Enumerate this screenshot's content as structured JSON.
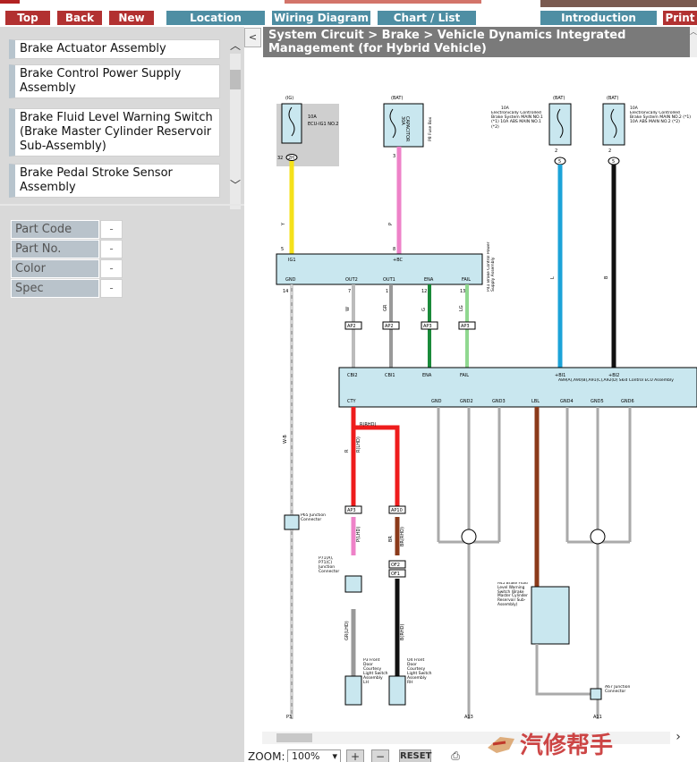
{
  "nav": {
    "top": "Top",
    "back": "Back",
    "new": "New",
    "location": "Location",
    "wiring": "Wiring Diagram",
    "chart": "Chart / List",
    "introduction": "Introduction",
    "print": "Print"
  },
  "components": [
    "Brake Actuator Assembly",
    "Brake Control Power Supply Assembly",
    "Brake Fluid Level Warning Switch (Brake Master Cylinder Reservoir Sub-Assembly)",
    "Brake Pedal Stroke Sensor Assembly"
  ],
  "properties": [
    {
      "label": "Part Code",
      "value": "-"
    },
    {
      "label": "Part No.",
      "value": "-"
    },
    {
      "label": "Color",
      "value": "-"
    },
    {
      "label": "Spec",
      "value": "-"
    }
  ],
  "title": "System Circuit > Brake > Vehicle Dynamics Integrated Management (for Hybrid Vehicle)",
  "zoom": {
    "label": "ZOOM:",
    "value": "100%",
    "reset": "RESET"
  },
  "watermark": "汽修帮手",
  "colors": {
    "nav_red": "#b23131",
    "nav_teal": "#4e8ea3",
    "title_bg": "#7a7a7a",
    "box_fill": "#c9e7ef"
  },
  "wiring": {
    "fuses": [
      {
        "source": "(IG)",
        "amp": "10A",
        "name": "ECU-IG1 NO.2",
        "pin": "32",
        "connector": "2H"
      },
      {
        "source": "(BAT)",
        "amp": "30A",
        "name": "CAPACITOR",
        "pin": "3",
        "connector": "P8 Fuse Box"
      },
      {
        "source": "(BAT)",
        "amp": "10A",
        "name": "Electronically Controlled Brake System MAIN NO.1 (*1) 10A ABS MAIN NO.1 (*2)",
        "pin": "2",
        "connector": "5"
      },
      {
        "source": "(BAT)",
        "amp": "10A",
        "name": "Electronically Controlled Brake System MAIN NO.2 (*1) 10A ABS MAIN NO.2 (*2)",
        "pin": "2",
        "connector": "5"
      }
    ],
    "power_supply": {
      "name": "P41 Brake Control Power Supply Assembly",
      "top_pins": [
        "IG1",
        "+BC"
      ],
      "bottom_pins": [
        "GND",
        "OUT2",
        "OUT1",
        "ENA",
        "FAIL"
      ],
      "pin_numbers": [
        "14",
        "7",
        "1",
        "12",
        "13"
      ]
    },
    "skid_ecu": {
      "name": "A89(A),A90(B),A91(C),A92(D) Skid Control ECU Assembly",
      "top_pins": [
        "CBI2",
        "CBI1",
        "ENA",
        "FAIL",
        "+BI1",
        "+BI2"
      ],
      "bottom_pins": [
        "CTY",
        "GND",
        "GND2",
        "GND3",
        "LBL",
        "GND4",
        "GND5",
        "GND6"
      ]
    },
    "junctions": [
      "AP2",
      "AP2",
      "AP3",
      "AP3",
      "AP3",
      "AP10",
      "OF2",
      "OF1"
    ],
    "wire_colors": [
      "Y",
      "P",
      "L",
      "B",
      "W",
      "GR",
      "G",
      "LG",
      "W-B",
      "R",
      "BR",
      "R(RHD)",
      "R(LHD)",
      "BR(RHD)",
      "P(LHD)",
      "GR(LHD)",
      "B(RHD)"
    ],
    "labels": {
      "p65": "P65 Junction Connector",
      "p71": "P71(A), P71(C) Junction Connector",
      "brake_fluid": "A45 Brake Fluid Level Warning Switch (Brake Master Cylinder Reservoir Sub-Assembly)",
      "a67": "A67 Junction Connector",
      "p3": "P3 Front Door Courtesy Light Switch Assembly LH",
      "o4": "O4 Front Door Courtesy Light Switch Assembly RH",
      "grounds": [
        "P3",
        "A13",
        "A11"
      ]
    }
  }
}
